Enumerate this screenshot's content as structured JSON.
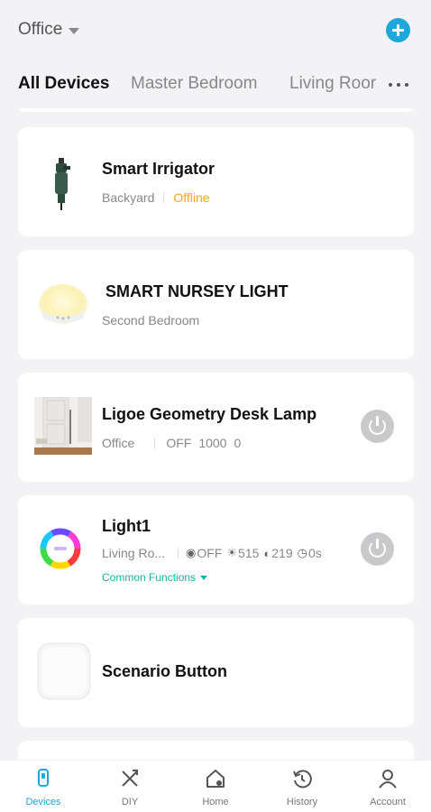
{
  "header": {
    "home_name": "Office",
    "add_icon": "plus-circle-icon",
    "accent_color": "#1ea7d9"
  },
  "tabs": [
    {
      "label": "All Devices",
      "active": true
    },
    {
      "label": "Master Bedroom",
      "active": false
    },
    {
      "label": "Living Roor",
      "active": false
    }
  ],
  "devices": [
    {
      "name": "Smart Irrigator",
      "room": "Backyard",
      "status": "Offline",
      "status_color": "#f4a71d"
    },
    {
      "name": "SMART NURSEY LIGHT",
      "room": "Second Bedroom"
    },
    {
      "name": "Ligoe Geometry Desk Lamp",
      "room": "Office",
      "state": "OFF",
      "brightness": "1000",
      "temperature": "0"
    },
    {
      "name": "Light1",
      "room": "Living Ro...",
      "power_state": "OFF",
      "brightness": "515",
      "temperature": "219",
      "timer": "0s",
      "common_functions": "Common Functions"
    },
    {
      "name": "Scenario Button"
    }
  ],
  "bottom_nav": [
    {
      "label": "Devices",
      "icon": "devices-icon",
      "active": true
    },
    {
      "label": "DIY",
      "icon": "diy-tools-icon",
      "active": false
    },
    {
      "label": "Home",
      "icon": "home-icon",
      "active": false
    },
    {
      "label": "History",
      "icon": "history-icon",
      "active": false
    },
    {
      "label": "Account",
      "icon": "account-icon",
      "active": false
    }
  ]
}
